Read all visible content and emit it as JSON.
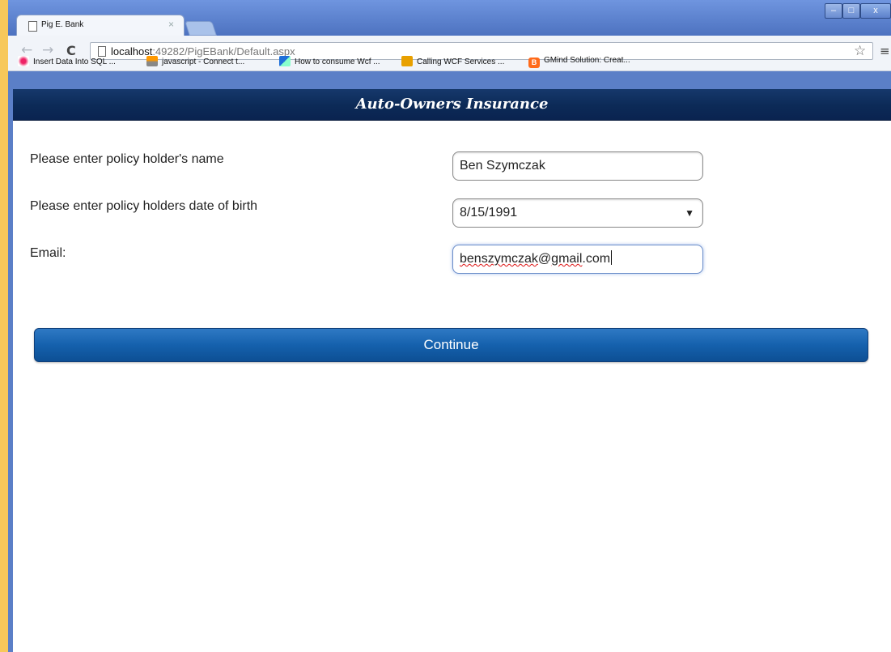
{
  "browser": {
    "tab_title": "Pig E. Bank",
    "tab_close": "×",
    "url_host": "localhost",
    "url_rest": ":49282/PigEBank/Default.aspx",
    "bookmarks": [
      {
        "label": "Insert Data Into SQL ..."
      },
      {
        "label": "javascript - Connect t..."
      },
      {
        "label": "How to consume Wcf ..."
      },
      {
        "label": "Calling WCF Services ..."
      },
      {
        "label": "GMind Solution: Creat..."
      }
    ],
    "window_controls": {
      "minimize": "–",
      "maximize": "□",
      "close": "x"
    }
  },
  "page": {
    "banner_title": "Auto-Owners Insurance",
    "form": {
      "name_label": "Please enter policy holder's name",
      "name_value": "Ben Szymczak",
      "dob_label": "Please enter policy holders date of birth",
      "dob_value": "8/15/1991",
      "email_label": "Email:",
      "email_value_misspelled_part1": "benszymczak",
      "email_value_mid": "@",
      "email_value_misspelled_part2": "gmail",
      "email_value_end": ".com"
    },
    "continue_label": "Continue"
  }
}
